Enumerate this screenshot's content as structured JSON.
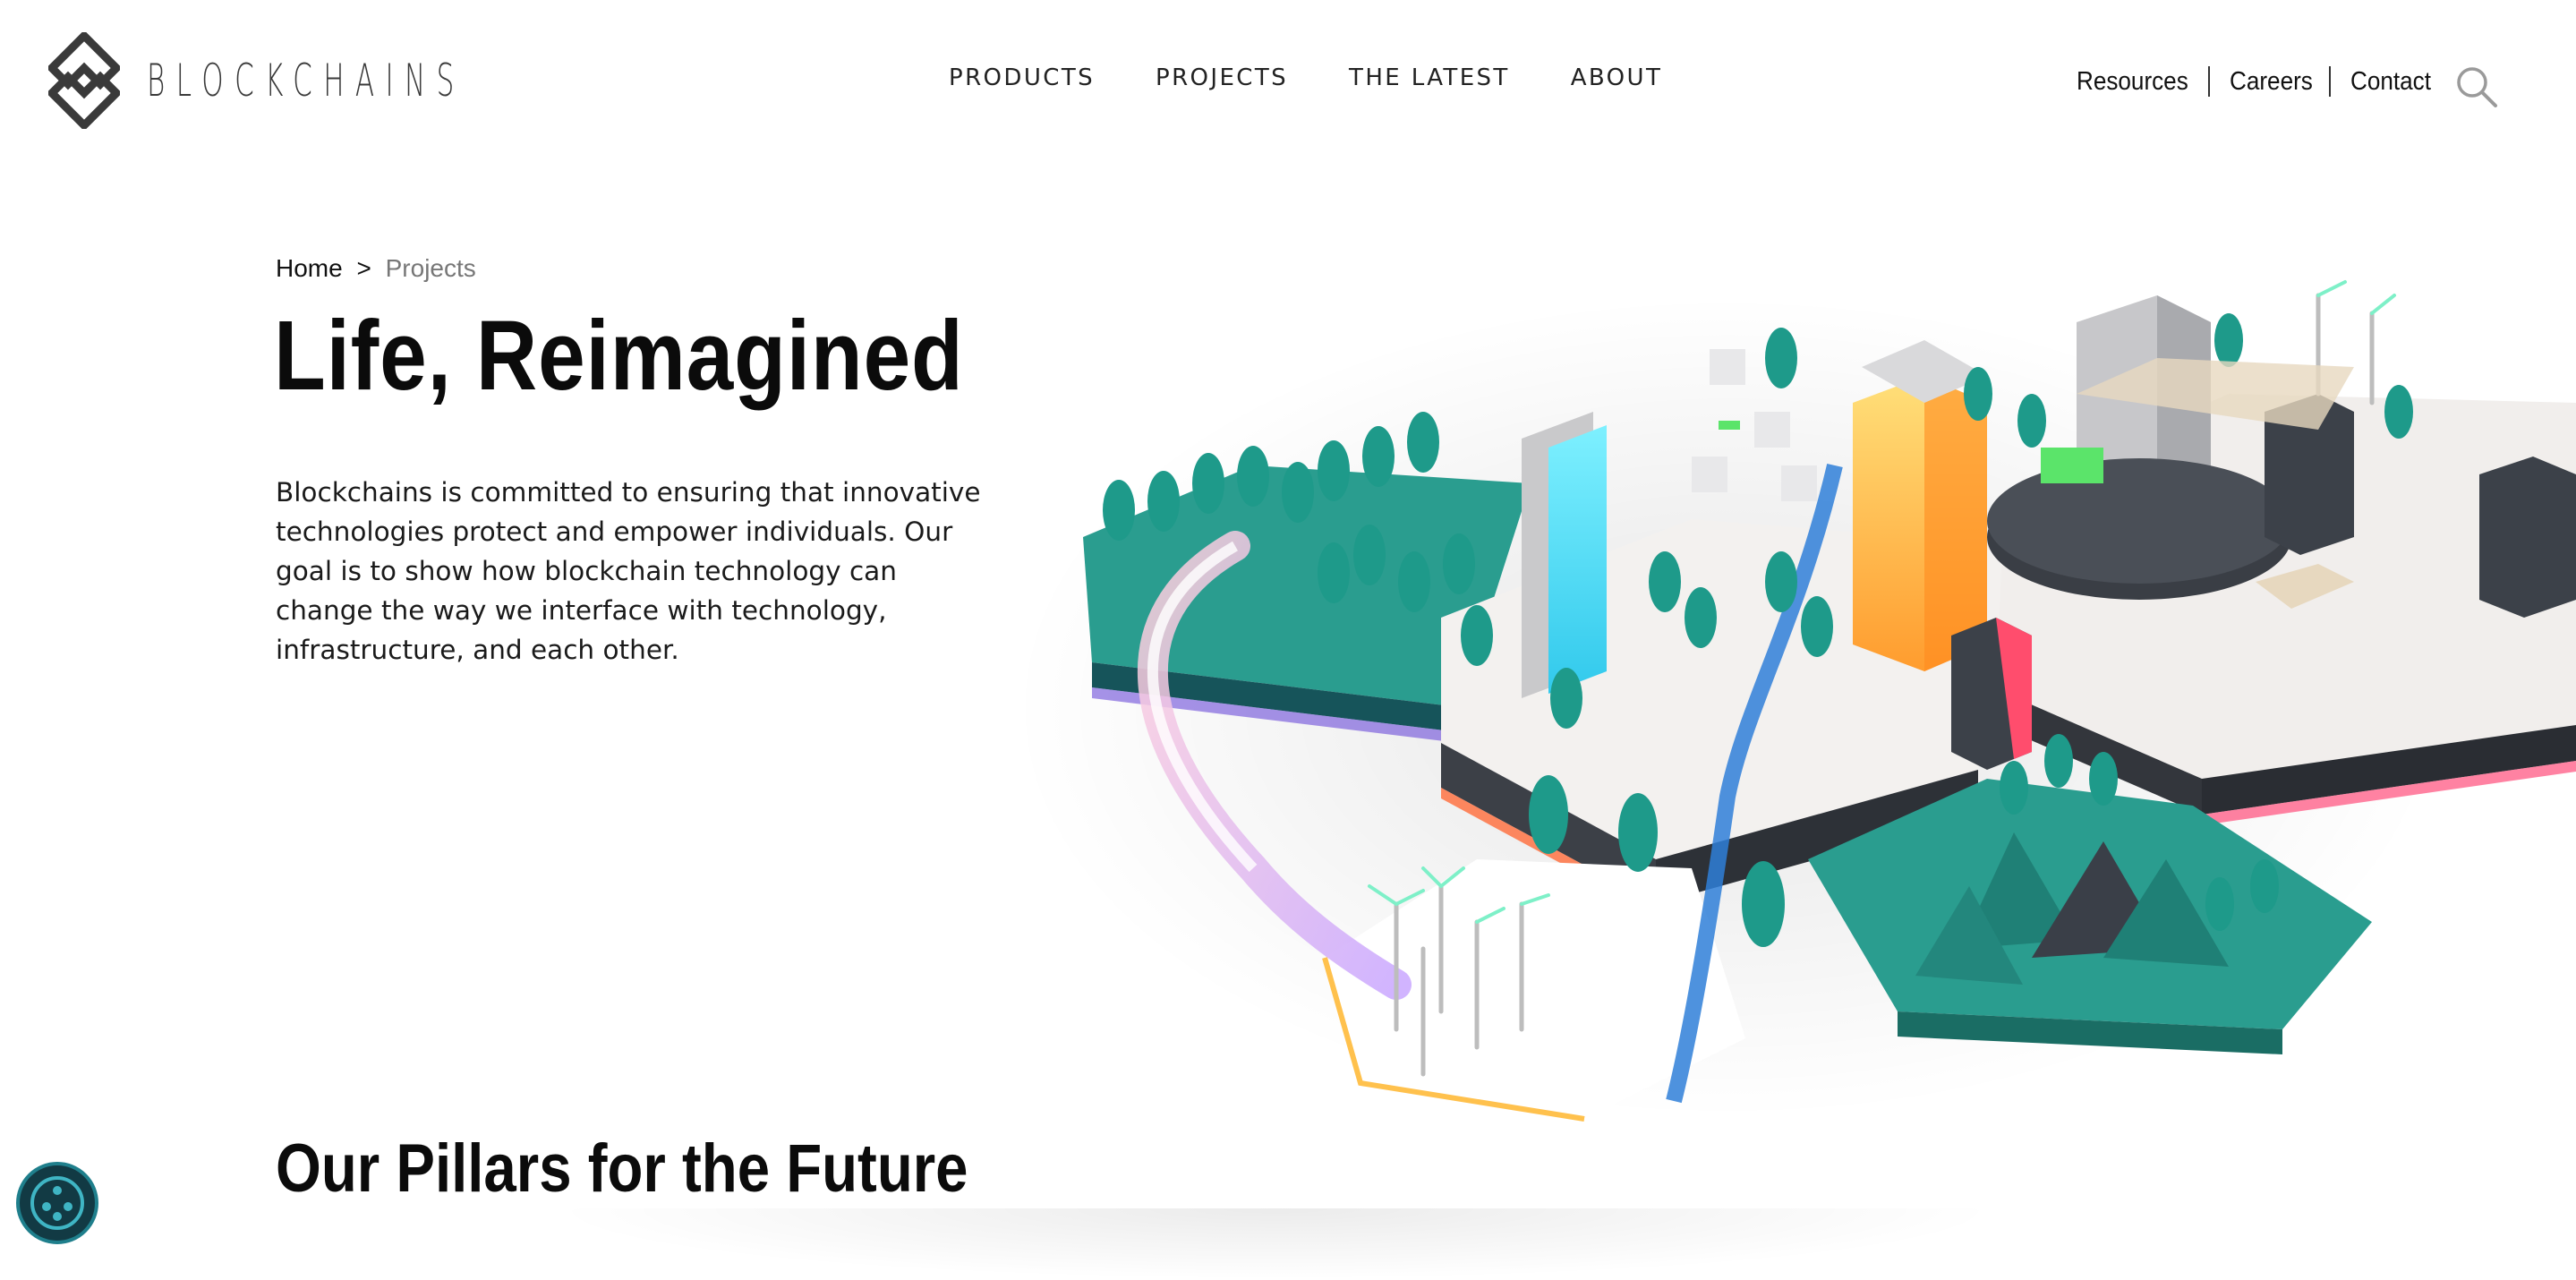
{
  "header": {
    "logo_text": "BLOCKCHAINS",
    "main_nav": [
      "PRODUCTS",
      "PROJECTS",
      "THE LATEST",
      "ABOUT"
    ],
    "util_nav": [
      "Resources",
      "Careers",
      "Contact"
    ],
    "search_icon": "search-icon"
  },
  "breadcrumb": {
    "home": "Home",
    "separator": ">",
    "current": "Projects"
  },
  "hero": {
    "title": "Life, Reimagined",
    "body": "Blockchains is committed to ensuring that innovative technologies protect and empower individuals. Our goal is to show how blockchain technology can change the way we interface with technology, infrastructure, and each other.",
    "illustration": "isometric-smart-city-illustration"
  },
  "pillars": {
    "title": "Our Pillars for the Future"
  },
  "accessibility_widget": {
    "icon": "accessibility-icon"
  },
  "colors": {
    "teal": "#2a9d8f",
    "dark_teal": "#1f7f73",
    "accent_cyan": "#3fd6f2",
    "accent_orange": "#ffb347",
    "text": "#111111"
  }
}
